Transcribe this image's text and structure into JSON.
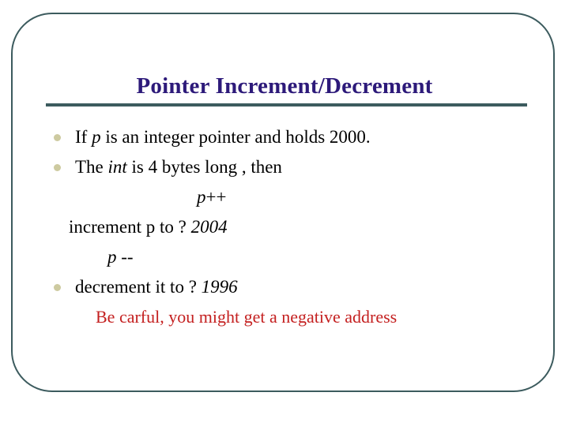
{
  "slide": {
    "title": "Pointer Increment/Decrement",
    "frame_color": "#3c5b5e",
    "title_color": "#2d1a7a",
    "bullet_color": "#cdcaa0",
    "warning_color": "#c42020",
    "background_color": "#ffffff"
  },
  "body": {
    "lines": [
      {
        "id": "line-1",
        "bullet": true,
        "parts": [
          {
            "text": "If ",
            "italic": false
          },
          {
            "text": "p",
            "italic": true
          },
          {
            "text": " is an integer pointer and holds 2000.",
            "italic": false
          }
        ],
        "plain": "If p is an integer pointer and holds 2000."
      },
      {
        "id": "line-2",
        "bullet": true,
        "parts": [
          {
            "text": "The ",
            "italic": false
          },
          {
            "text": "int",
            "italic": true
          },
          {
            "text": " is 4 bytes long , then",
            "italic": false
          }
        ],
        "plain": "The int is 4 bytes long , then"
      },
      {
        "id": "line-3",
        "bullet": false,
        "parts": [
          {
            "text": "p",
            "italic": true
          },
          {
            "text": "++",
            "italic": false
          }
        ],
        "plain": "p++"
      },
      {
        "id": "line-4",
        "bullet": false,
        "parts": [
          {
            "text": "increment p to ? ",
            "italic": false
          },
          {
            "text": "2004",
            "italic": true
          }
        ],
        "plain": "increment p to ? 2004"
      },
      {
        "id": "line-5",
        "bullet": false,
        "parts": [
          {
            "text": "p",
            "italic": true
          },
          {
            "text": " --",
            "italic": false
          }
        ],
        "plain": "p --"
      },
      {
        "id": "line-6",
        "bullet": true,
        "parts": [
          {
            "text": "decrement it to ? ",
            "italic": false
          },
          {
            "text": "1996",
            "italic": true
          }
        ],
        "plain": "decrement it to ? 1996"
      },
      {
        "id": "line-7",
        "bullet": false,
        "parts": [
          {
            "text": "Be carful, you might get a negative address",
            "italic": false
          }
        ],
        "plain": "Be carful, you might get a negative address"
      }
    ]
  }
}
